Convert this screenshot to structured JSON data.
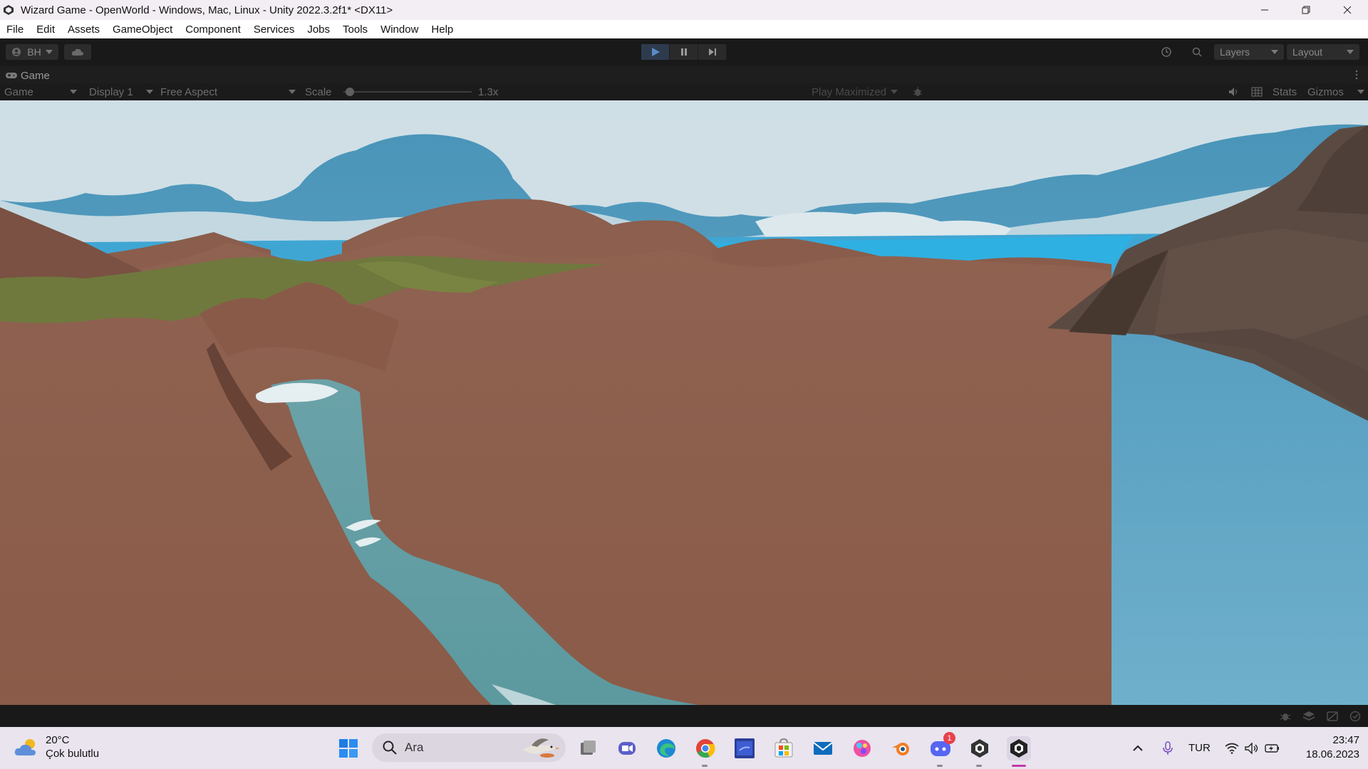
{
  "window": {
    "title": "Wizard Game - OpenWorld - Windows, Mac, Linux - Unity 2022.3.2f1* <DX11>",
    "icons": [
      "unity-logo-icon",
      "minimize-icon",
      "restore-icon",
      "close-icon"
    ]
  },
  "menu": {
    "items": [
      "File",
      "Edit",
      "Assets",
      "GameObject",
      "Component",
      "Services",
      "Jobs",
      "Tools",
      "Window",
      "Help"
    ]
  },
  "toolbar": {
    "account_label": "BH",
    "layers_label": "Layers",
    "layout_label": "Layout",
    "icons": [
      "account-icon",
      "cloud-icon",
      "play-icon",
      "pause-icon",
      "step-icon",
      "history-icon",
      "search-icon"
    ]
  },
  "game_tab": {
    "label": "Game",
    "icon": "gamepad-icon"
  },
  "game_controls": {
    "view_mode": "Game",
    "display": "Display 1",
    "aspect": "Free Aspect",
    "scale_label": "Scale",
    "scale_value": "1.3x",
    "scale_fraction": 0.05,
    "play_mode": "Play Maximized",
    "stats_label": "Stats",
    "gizmos_label": "Gizmos"
  },
  "taskbar": {
    "weather_temp": "20°C",
    "weather_desc": "Çok bulutlu",
    "search_placeholder": "Ara",
    "language": "TUR",
    "time": "23:47",
    "date": "18.06.2023",
    "discord_badge": "1",
    "apps": [
      "windows-start-icon",
      "task-view-icon",
      "teams-icon",
      "edge-icon",
      "chrome-icon",
      "visual-studio-icon",
      "store-icon",
      "mail-icon",
      "paint-icon",
      "blender-icon",
      "discord-icon",
      "unity-hub-icon",
      "unity-editor-icon"
    ]
  },
  "colors": {
    "sky": "#4e9dbf",
    "terrain": "#8d5e4c",
    "water": "#5e9ea3",
    "grass": "#6f7a3e",
    "editor_bg": "#191919",
    "play_active": "#2e3b4f"
  }
}
